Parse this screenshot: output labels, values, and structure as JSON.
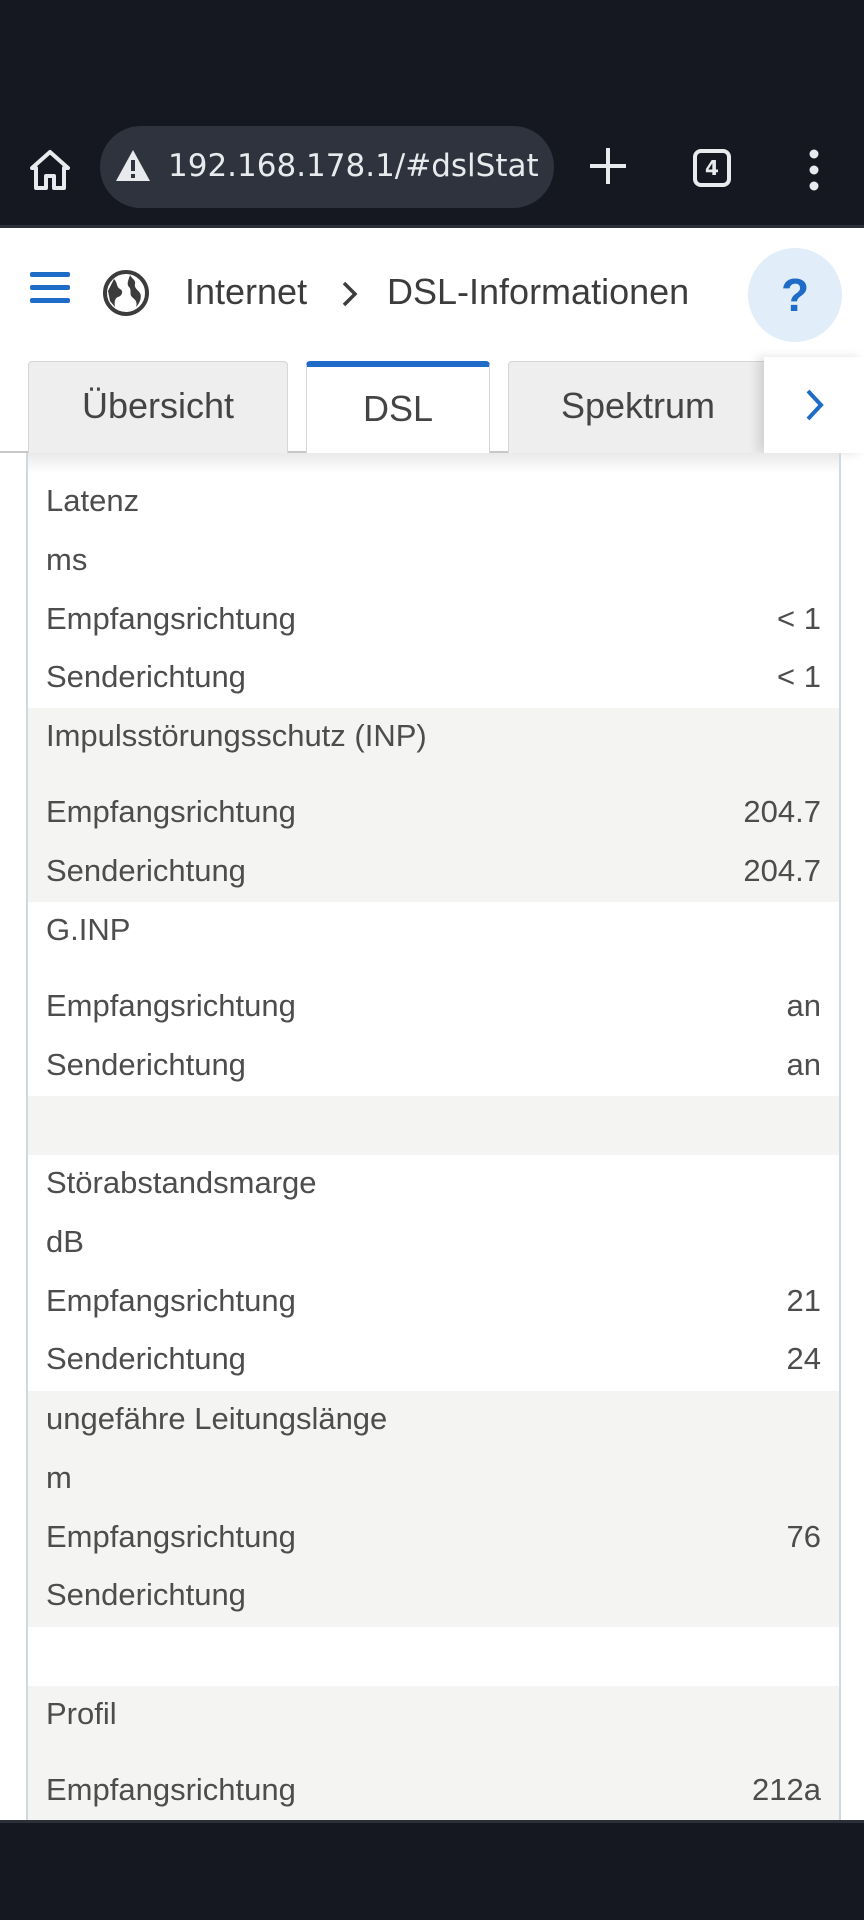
{
  "browser": {
    "url": "192.168.178.1/#dslStat",
    "tab_count": "4"
  },
  "header": {
    "breadcrumb": [
      "Internet",
      "DSL-Informationen"
    ],
    "help": "?"
  },
  "tabs": [
    {
      "label": "Übersicht",
      "active": false
    },
    {
      "label": "DSL",
      "active": true
    },
    {
      "label": "Spektrum",
      "active": false
    }
  ],
  "sections": [
    {
      "title": "Latenz",
      "unit": "ms",
      "rows": [
        {
          "label": "Empfangsrichtung",
          "value": "< 1"
        },
        {
          "label": "Senderichtung",
          "value": "< 1"
        }
      ]
    },
    {
      "title": "Impulsstörungsschutz (INP)",
      "rows": [
        {
          "label": "Empfangsrichtung",
          "value": "204.7"
        },
        {
          "label": "Senderichtung",
          "value": "204.7"
        }
      ]
    },
    {
      "title": "G.INP",
      "rows": [
        {
          "label": "Empfangsrichtung",
          "value": "an"
        },
        {
          "label": "Senderichtung",
          "value": "an"
        }
      ]
    },
    {
      "title": "Störabstandsmarge",
      "unit": "dB",
      "rows": [
        {
          "label": "Empfangsrichtung",
          "value": "21"
        },
        {
          "label": "Senderichtung",
          "value": "24"
        }
      ]
    },
    {
      "title": "ungefähre Leitungslänge",
      "unit": "m",
      "rows": [
        {
          "label": "Empfangsrichtung",
          "value": "76"
        },
        {
          "label": "Senderichtung",
          "value": ""
        }
      ]
    },
    {
      "title": "Profil",
      "rows": [
        {
          "label": "Empfangsrichtung",
          "value": "212a"
        }
      ]
    }
  ],
  "colors": {
    "accent": "#1e6bc8",
    "row_alt": "#f4f4f3",
    "chrome": "#151820"
  }
}
